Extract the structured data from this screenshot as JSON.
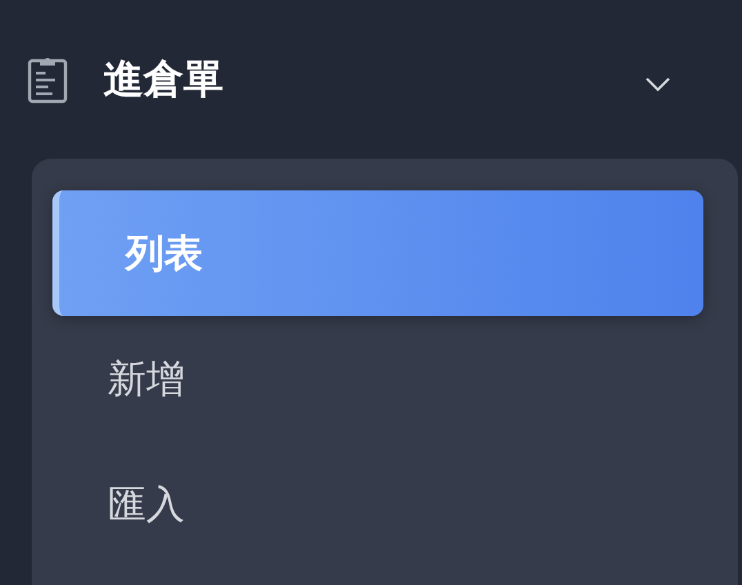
{
  "menu": {
    "title": "進倉單",
    "expanded": true
  },
  "items": [
    {
      "label": "列表",
      "selected": true
    },
    {
      "label": "新增",
      "selected": false
    },
    {
      "label": "匯入",
      "selected": false
    }
  ]
}
